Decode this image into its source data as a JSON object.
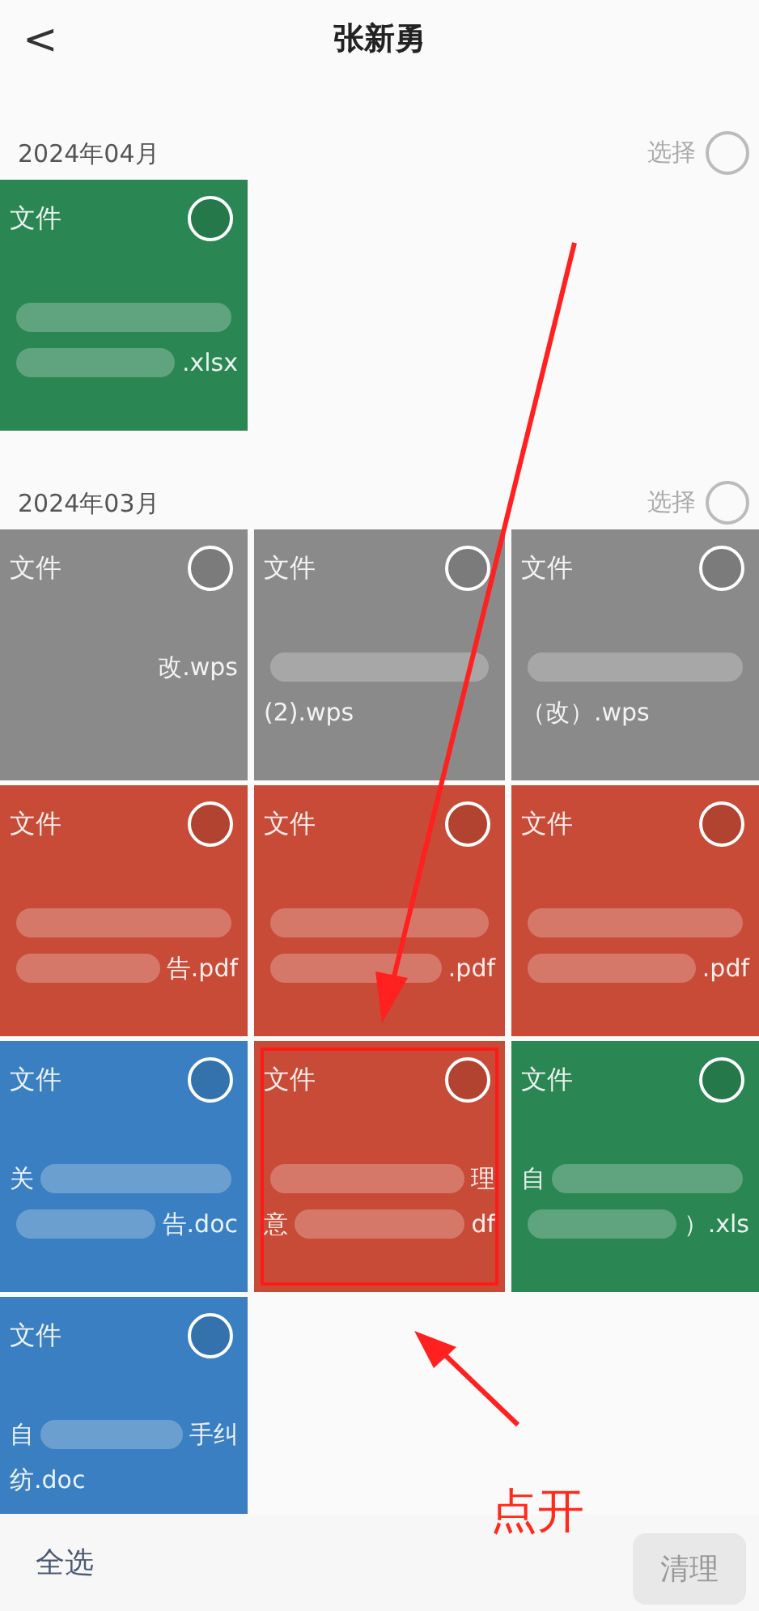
{
  "header": {
    "back": "<",
    "title": "张新勇"
  },
  "sections": [
    {
      "date": "2024年04月",
      "select_label": "选择",
      "selected": false,
      "tiles": [
        {
          "color": "#2a8653",
          "label": "文件",
          "selected": false,
          "highlighted": false,
          "lines": [
            {
              "blur": true
            },
            {
              "blur": true,
              "after": ".xlsx"
            }
          ]
        }
      ]
    },
    {
      "date": "2024年03月",
      "select_label": "选择",
      "selected": false,
      "tiles": [
        {
          "color": "#8a8a8a",
          "label": "文件",
          "selected": false,
          "highlighted": false,
          "lines": [
            {
              "blur": false,
              "after": "改.wps"
            }
          ]
        },
        {
          "color": "#8a8a8a",
          "label": "文件",
          "selected": false,
          "highlighted": false,
          "lines": [
            {
              "blur": true
            },
            {
              "blur": false,
              "before": "(2).wps"
            }
          ]
        },
        {
          "color": "#8a8a8a",
          "label": "文件",
          "selected": false,
          "highlighted": false,
          "lines": [
            {
              "blur": true
            },
            {
              "blur": false,
              "before": "（改）.wps"
            }
          ]
        },
        {
          "color": "#c84b37",
          "label": "文件",
          "selected": false,
          "highlighted": false,
          "lines": [
            {
              "blur": true
            },
            {
              "blur": true,
              "after": "告.pdf"
            }
          ]
        },
        {
          "color": "#c84b37",
          "label": "文件",
          "selected": false,
          "highlighted": false,
          "lines": [
            {
              "blur": true
            },
            {
              "blur": true,
              "after": ".pdf"
            }
          ]
        },
        {
          "color": "#c84b37",
          "label": "文件",
          "selected": false,
          "highlighted": false,
          "lines": [
            {
              "blur": true
            },
            {
              "blur": true,
              "after": ".pdf"
            }
          ]
        },
        {
          "color": "#3a7fc1",
          "label": "文件",
          "selected": false,
          "highlighted": false,
          "lines": [
            {
              "blur": true,
              "before": "关"
            },
            {
              "blur": true,
              "after": "告.doc"
            }
          ]
        },
        {
          "color": "#c84b37",
          "label": "文件",
          "selected": false,
          "highlighted": true,
          "lines": [
            {
              "blur": true,
              "after": "理"
            },
            {
              "blur": true,
              "before": "意",
              "after": "df"
            }
          ]
        },
        {
          "color": "#2a8653",
          "label": "文件",
          "selected": false,
          "highlighted": false,
          "lines": [
            {
              "blur": true,
              "before": "自"
            },
            {
              "blur": true,
              "after": "）.xls"
            }
          ]
        },
        {
          "color": "#3a7fc1",
          "label": "文件",
          "selected": false,
          "highlighted": false,
          "lines": [
            {
              "blur": true,
              "before": "自",
              "after": "手纠"
            },
            {
              "blur": false,
              "before": "纺.doc"
            }
          ]
        }
      ]
    }
  ],
  "annotation": {
    "text": "点开"
  },
  "footer": {
    "select_all": "全选",
    "clean": "清理",
    "clean_disabled": true
  }
}
